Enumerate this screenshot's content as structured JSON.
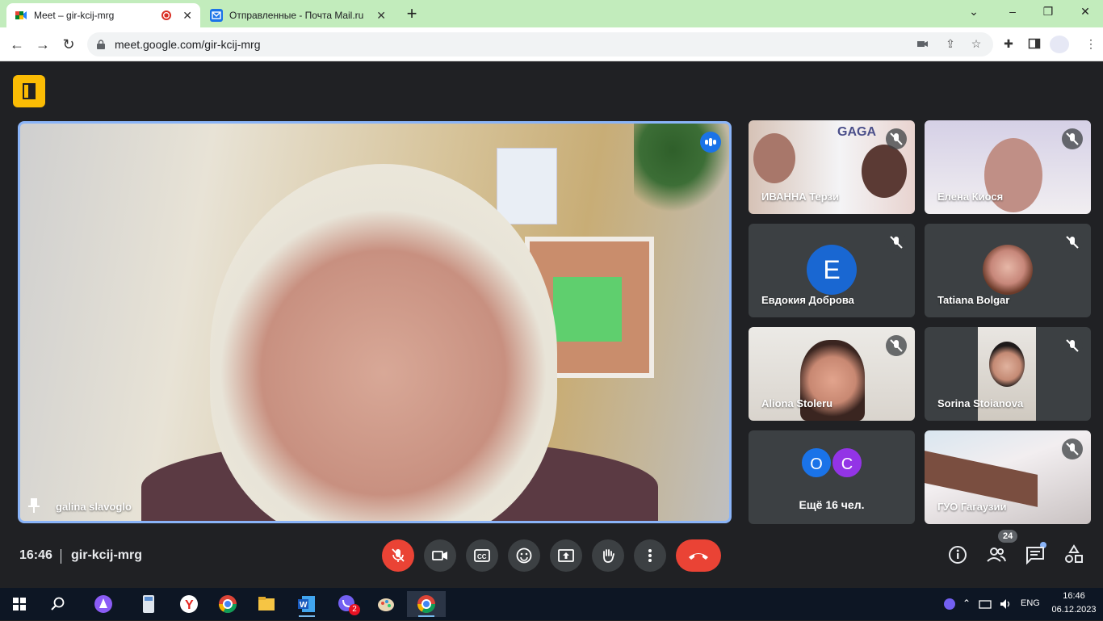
{
  "browser": {
    "tabs": [
      {
        "title": "Meet – gir-kcij-mrg",
        "active": true,
        "recording": true
      },
      {
        "title": "Отправленные - Почта Mail.ru",
        "active": false
      }
    ],
    "new_tab": "+",
    "url": "meet.google.com/gir-kcij-mrg"
  },
  "meet": {
    "main_speaker": {
      "name": "galina slavoglo"
    },
    "tiles": [
      {
        "name": "ИВАННА Терзи",
        "muted": true,
        "kind": "video"
      },
      {
        "name": "Елена Киося",
        "muted": true,
        "kind": "video"
      },
      {
        "name": "Евдокия Доброва",
        "muted": true,
        "kind": "avatar",
        "initial": "E"
      },
      {
        "name": "Tatiana Bolgar",
        "muted": true,
        "kind": "photo"
      },
      {
        "name": "Aliona Stoleru",
        "muted": true,
        "kind": "video"
      },
      {
        "name": "Sorina Stoianova",
        "muted": true,
        "kind": "video"
      },
      {
        "name": "Ещё 16 чел.",
        "kind": "more",
        "initials": [
          "O",
          "C"
        ]
      },
      {
        "name": "ГУО Гагаузии",
        "muted": true,
        "kind": "video"
      }
    ],
    "bottom": {
      "time": "16:46",
      "code": "gir-kcij-mrg",
      "people_count": "24"
    },
    "colors": {
      "hangup": "#ea4335",
      "accent": "#8ab4f8",
      "more_o": "#1a73e8",
      "more_c": "#9334e6"
    }
  },
  "taskbar": {
    "time": "16:46",
    "date": "06.12.2023",
    "lang": "ENG",
    "viber_badge": "2"
  }
}
